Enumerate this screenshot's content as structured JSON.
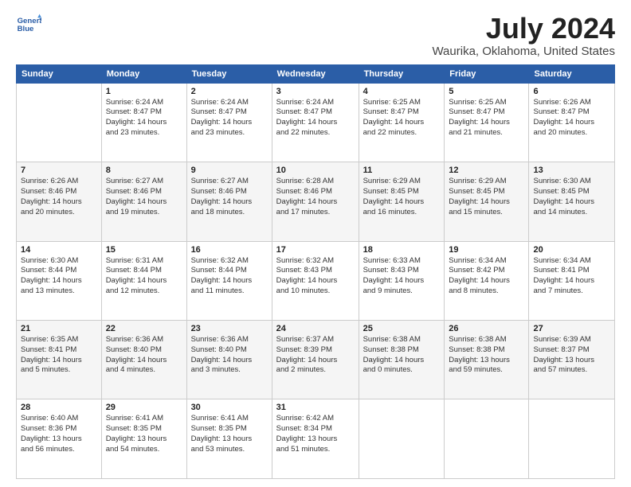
{
  "logo": {
    "line1": "General",
    "line2": "Blue"
  },
  "title": "July 2024",
  "subtitle": "Waurika, Oklahoma, United States",
  "days_of_week": [
    "Sunday",
    "Monday",
    "Tuesday",
    "Wednesday",
    "Thursday",
    "Friday",
    "Saturday"
  ],
  "weeks": [
    [
      {
        "day": "",
        "info": ""
      },
      {
        "day": "1",
        "info": "Sunrise: 6:24 AM\nSunset: 8:47 PM\nDaylight: 14 hours\nand 23 minutes."
      },
      {
        "day": "2",
        "info": "Sunrise: 6:24 AM\nSunset: 8:47 PM\nDaylight: 14 hours\nand 23 minutes."
      },
      {
        "day": "3",
        "info": "Sunrise: 6:24 AM\nSunset: 8:47 PM\nDaylight: 14 hours\nand 22 minutes."
      },
      {
        "day": "4",
        "info": "Sunrise: 6:25 AM\nSunset: 8:47 PM\nDaylight: 14 hours\nand 22 minutes."
      },
      {
        "day": "5",
        "info": "Sunrise: 6:25 AM\nSunset: 8:47 PM\nDaylight: 14 hours\nand 21 minutes."
      },
      {
        "day": "6",
        "info": "Sunrise: 6:26 AM\nSunset: 8:47 PM\nDaylight: 14 hours\nand 20 minutes."
      }
    ],
    [
      {
        "day": "7",
        "info": "Sunrise: 6:26 AM\nSunset: 8:46 PM\nDaylight: 14 hours\nand 20 minutes."
      },
      {
        "day": "8",
        "info": "Sunrise: 6:27 AM\nSunset: 8:46 PM\nDaylight: 14 hours\nand 19 minutes."
      },
      {
        "day": "9",
        "info": "Sunrise: 6:27 AM\nSunset: 8:46 PM\nDaylight: 14 hours\nand 18 minutes."
      },
      {
        "day": "10",
        "info": "Sunrise: 6:28 AM\nSunset: 8:46 PM\nDaylight: 14 hours\nand 17 minutes."
      },
      {
        "day": "11",
        "info": "Sunrise: 6:29 AM\nSunset: 8:45 PM\nDaylight: 14 hours\nand 16 minutes."
      },
      {
        "day": "12",
        "info": "Sunrise: 6:29 AM\nSunset: 8:45 PM\nDaylight: 14 hours\nand 15 minutes."
      },
      {
        "day": "13",
        "info": "Sunrise: 6:30 AM\nSunset: 8:45 PM\nDaylight: 14 hours\nand 14 minutes."
      }
    ],
    [
      {
        "day": "14",
        "info": "Sunrise: 6:30 AM\nSunset: 8:44 PM\nDaylight: 14 hours\nand 13 minutes."
      },
      {
        "day": "15",
        "info": "Sunrise: 6:31 AM\nSunset: 8:44 PM\nDaylight: 14 hours\nand 12 minutes."
      },
      {
        "day": "16",
        "info": "Sunrise: 6:32 AM\nSunset: 8:44 PM\nDaylight: 14 hours\nand 11 minutes."
      },
      {
        "day": "17",
        "info": "Sunrise: 6:32 AM\nSunset: 8:43 PM\nDaylight: 14 hours\nand 10 minutes."
      },
      {
        "day": "18",
        "info": "Sunrise: 6:33 AM\nSunset: 8:43 PM\nDaylight: 14 hours\nand 9 minutes."
      },
      {
        "day": "19",
        "info": "Sunrise: 6:34 AM\nSunset: 8:42 PM\nDaylight: 14 hours\nand 8 minutes."
      },
      {
        "day": "20",
        "info": "Sunrise: 6:34 AM\nSunset: 8:41 PM\nDaylight: 14 hours\nand 7 minutes."
      }
    ],
    [
      {
        "day": "21",
        "info": "Sunrise: 6:35 AM\nSunset: 8:41 PM\nDaylight: 14 hours\nand 5 minutes."
      },
      {
        "day": "22",
        "info": "Sunrise: 6:36 AM\nSunset: 8:40 PM\nDaylight: 14 hours\nand 4 minutes."
      },
      {
        "day": "23",
        "info": "Sunrise: 6:36 AM\nSunset: 8:40 PM\nDaylight: 14 hours\nand 3 minutes."
      },
      {
        "day": "24",
        "info": "Sunrise: 6:37 AM\nSunset: 8:39 PM\nDaylight: 14 hours\nand 2 minutes."
      },
      {
        "day": "25",
        "info": "Sunrise: 6:38 AM\nSunset: 8:38 PM\nDaylight: 14 hours\nand 0 minutes."
      },
      {
        "day": "26",
        "info": "Sunrise: 6:38 AM\nSunset: 8:38 PM\nDaylight: 13 hours\nand 59 minutes."
      },
      {
        "day": "27",
        "info": "Sunrise: 6:39 AM\nSunset: 8:37 PM\nDaylight: 13 hours\nand 57 minutes."
      }
    ],
    [
      {
        "day": "28",
        "info": "Sunrise: 6:40 AM\nSunset: 8:36 PM\nDaylight: 13 hours\nand 56 minutes."
      },
      {
        "day": "29",
        "info": "Sunrise: 6:41 AM\nSunset: 8:35 PM\nDaylight: 13 hours\nand 54 minutes."
      },
      {
        "day": "30",
        "info": "Sunrise: 6:41 AM\nSunset: 8:35 PM\nDaylight: 13 hours\nand 53 minutes."
      },
      {
        "day": "31",
        "info": "Sunrise: 6:42 AM\nSunset: 8:34 PM\nDaylight: 13 hours\nand 51 minutes."
      },
      {
        "day": "",
        "info": ""
      },
      {
        "day": "",
        "info": ""
      },
      {
        "day": "",
        "info": ""
      }
    ]
  ]
}
